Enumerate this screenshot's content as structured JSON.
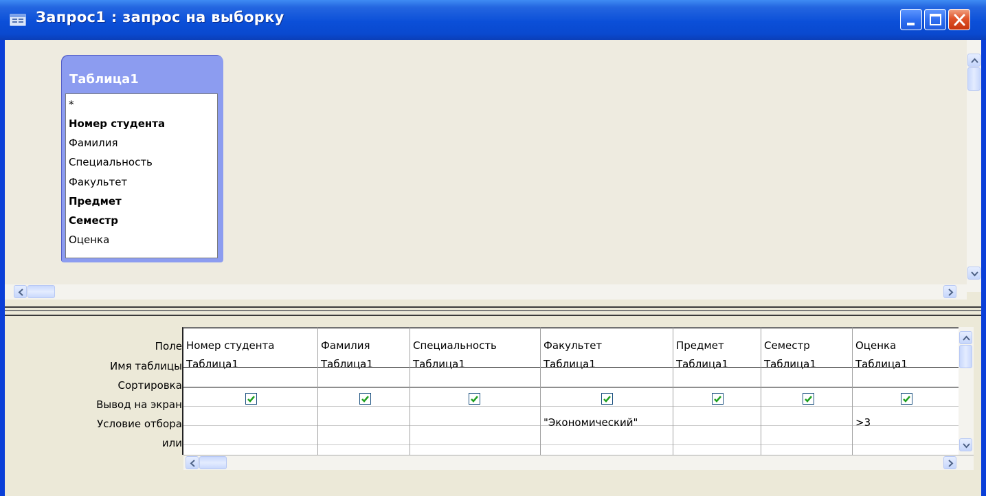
{
  "window": {
    "title": "Запрос1 : запрос на выборку",
    "icon": "query-window-icon",
    "controls": [
      "minimize-icon",
      "maximize-icon",
      "close-icon"
    ]
  },
  "table_box": {
    "title": "Таблица1",
    "fields": [
      {
        "label": "*",
        "bold": false
      },
      {
        "label": "Номер студента",
        "bold": true
      },
      {
        "label": "Фамилия",
        "bold": false
      },
      {
        "label": "Специальность",
        "bold": false
      },
      {
        "label": "Факультет",
        "bold": false
      },
      {
        "label": "Предмет",
        "bold": true
      },
      {
        "label": "Семестр",
        "bold": true
      },
      {
        "label": "Оценка",
        "bold": false
      }
    ]
  },
  "grid": {
    "row_labels": {
      "field": "Поле:",
      "table": "Имя таблицы:",
      "sort": "Сортировка:",
      "show": "Вывод на экран:",
      "criteria": "Условие отбора:",
      "or": "или:"
    },
    "columns": [
      {
        "field": "Номер студента",
        "table": "Таблица1",
        "sort": "",
        "show": true,
        "criteria": "",
        "or": ""
      },
      {
        "field": "Фамилия",
        "table": "Таблица1",
        "sort": "",
        "show": true,
        "criteria": "",
        "or": ""
      },
      {
        "field": "Специальность",
        "table": "Таблица1",
        "sort": "",
        "show": true,
        "criteria": "",
        "or": ""
      },
      {
        "field": "Факультет",
        "table": "Таблица1",
        "sort": "",
        "show": true,
        "criteria": "\"Экономический\"",
        "or": ""
      },
      {
        "field": "Предмет",
        "table": "Таблица1",
        "sort": "",
        "show": true,
        "criteria": "",
        "or": ""
      },
      {
        "field": "Семестр",
        "table": "Таблица1",
        "sort": "",
        "show": true,
        "criteria": "",
        "or": ""
      },
      {
        "field": "Оценка",
        "table": "Таблица1",
        "sort": "",
        "show": true,
        "criteria": ">3",
        "or": ""
      }
    ]
  },
  "colors": {
    "titlebar": "#0b4fd8",
    "pane_background": "#ece9d8",
    "table_box": "#8c9cf0",
    "checkbox_mark": "#21a121"
  }
}
